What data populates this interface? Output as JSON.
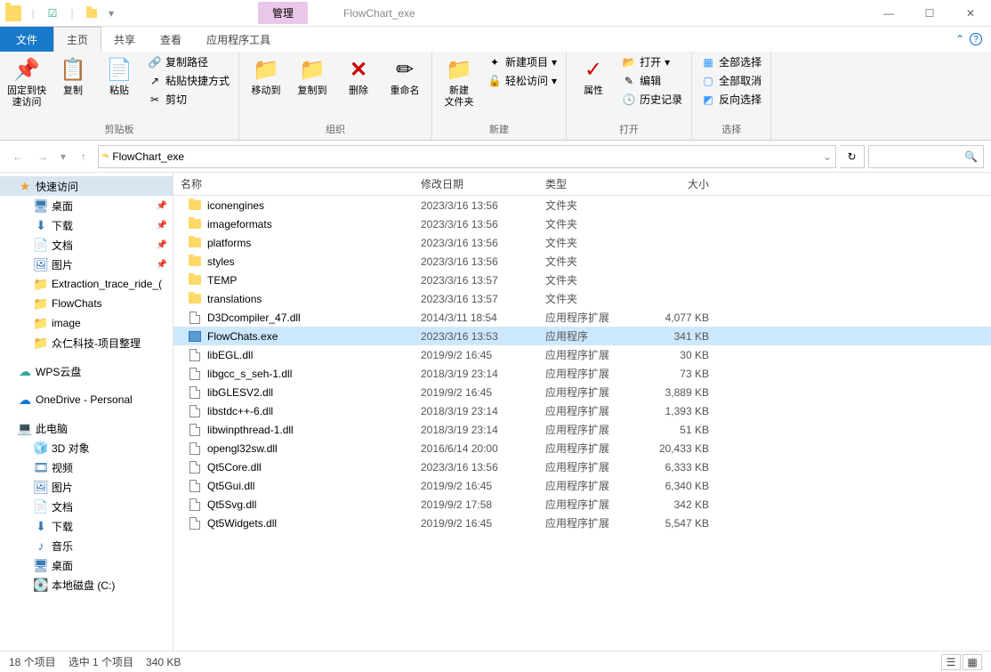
{
  "window": {
    "manage_tab": "管理",
    "title": "FlowChart_exe"
  },
  "menu": {
    "file": "文件",
    "home": "主页",
    "share": "共享",
    "view": "查看",
    "apptools": "应用程序工具"
  },
  "ribbon": {
    "clipboard": {
      "pin": "固定到快\n速访问",
      "copy": "复制",
      "paste": "粘贴",
      "copy_path": "复制路径",
      "paste_shortcut": "粘贴快捷方式",
      "cut": "剪切",
      "label": "剪贴板"
    },
    "organize": {
      "moveto": "移动到",
      "copyto": "复制到",
      "delete": "删除",
      "rename": "重命名",
      "label": "组织"
    },
    "new": {
      "newfolder": "新建\n文件夹",
      "newitem": "新建项目",
      "easyaccess": "轻松访问",
      "label": "新建"
    },
    "open": {
      "properties": "属性",
      "open": "打开",
      "edit": "编辑",
      "history": "历史记录",
      "label": "打开"
    },
    "select": {
      "selectall": "全部选择",
      "selectnone": "全部取消",
      "invert": "反向选择",
      "label": "选择"
    }
  },
  "address": {
    "path": "FlowChart_exe"
  },
  "nav": {
    "items": [
      {
        "icon": "star",
        "label": "快速访问",
        "level": 1,
        "selected": true
      },
      {
        "icon": "desktop",
        "label": "桌面",
        "level": 2,
        "pin": true
      },
      {
        "icon": "download",
        "label": "下载",
        "level": 2,
        "pin": true
      },
      {
        "icon": "doc",
        "label": "文档",
        "level": 2,
        "pin": true
      },
      {
        "icon": "pic",
        "label": "图片",
        "level": 2,
        "pin": true
      },
      {
        "icon": "folder",
        "label": "Extraction_trace_ride_(",
        "level": 2
      },
      {
        "icon": "folder",
        "label": "FlowChats",
        "level": 2
      },
      {
        "icon": "folder",
        "label": "image",
        "level": 2
      },
      {
        "icon": "folder",
        "label": "众仁科技-项目整理",
        "level": 2
      },
      {
        "sep": true
      },
      {
        "icon": "cloud-wps",
        "label": "WPS云盘",
        "level": 1
      },
      {
        "sep": true
      },
      {
        "icon": "cloud-od",
        "label": "OneDrive - Personal",
        "level": 1
      },
      {
        "sep": true
      },
      {
        "icon": "pc",
        "label": "此电脑",
        "level": 1
      },
      {
        "icon": "3d",
        "label": "3D 对象",
        "level": 2
      },
      {
        "icon": "video",
        "label": "视频",
        "level": 2
      },
      {
        "icon": "pic",
        "label": "图片",
        "level": 2
      },
      {
        "icon": "doc",
        "label": "文档",
        "level": 2
      },
      {
        "icon": "download",
        "label": "下载",
        "level": 2
      },
      {
        "icon": "music",
        "label": "音乐",
        "level": 2
      },
      {
        "icon": "desktop",
        "label": "桌面",
        "level": 2
      },
      {
        "icon": "disk",
        "label": "本地磁盘 (C:)",
        "level": 2
      }
    ]
  },
  "columns": {
    "name": "名称",
    "date": "修改日期",
    "type": "类型",
    "size": "大小"
  },
  "files": [
    {
      "icon": "folder",
      "name": "iconengines",
      "date": "2023/3/16 13:56",
      "type": "文件夹",
      "size": ""
    },
    {
      "icon": "folder",
      "name": "imageformats",
      "date": "2023/3/16 13:56",
      "type": "文件夹",
      "size": ""
    },
    {
      "icon": "folder",
      "name": "platforms",
      "date": "2023/3/16 13:56",
      "type": "文件夹",
      "size": ""
    },
    {
      "icon": "folder",
      "name": "styles",
      "date": "2023/3/16 13:56",
      "type": "文件夹",
      "size": ""
    },
    {
      "icon": "folder",
      "name": "TEMP",
      "date": "2023/3/16 13:57",
      "type": "文件夹",
      "size": ""
    },
    {
      "icon": "folder",
      "name": "translations",
      "date": "2023/3/16 13:57",
      "type": "文件夹",
      "size": ""
    },
    {
      "icon": "dll",
      "name": "D3Dcompiler_47.dll",
      "date": "2014/3/11 18:54",
      "type": "应用程序扩展",
      "size": "4,077 KB"
    },
    {
      "icon": "exe",
      "name": "FlowChats.exe",
      "date": "2023/3/16 13:53",
      "type": "应用程序",
      "size": "341 KB",
      "selected": true
    },
    {
      "icon": "dll",
      "name": "libEGL.dll",
      "date": "2019/9/2 16:45",
      "type": "应用程序扩展",
      "size": "30 KB"
    },
    {
      "icon": "dll",
      "name": "libgcc_s_seh-1.dll",
      "date": "2018/3/19 23:14",
      "type": "应用程序扩展",
      "size": "73 KB"
    },
    {
      "icon": "dll",
      "name": "libGLESV2.dll",
      "date": "2019/9/2 16:45",
      "type": "应用程序扩展",
      "size": "3,889 KB"
    },
    {
      "icon": "dll",
      "name": "libstdc++-6.dll",
      "date": "2018/3/19 23:14",
      "type": "应用程序扩展",
      "size": "1,393 KB"
    },
    {
      "icon": "dll",
      "name": "libwinpthread-1.dll",
      "date": "2018/3/19 23:14",
      "type": "应用程序扩展",
      "size": "51 KB"
    },
    {
      "icon": "dll",
      "name": "opengl32sw.dll",
      "date": "2016/6/14 20:00",
      "type": "应用程序扩展",
      "size": "20,433 KB"
    },
    {
      "icon": "dll",
      "name": "Qt5Core.dll",
      "date": "2023/3/16 13:56",
      "type": "应用程序扩展",
      "size": "6,333 KB"
    },
    {
      "icon": "dll",
      "name": "Qt5Gui.dll",
      "date": "2019/9/2 16:45",
      "type": "应用程序扩展",
      "size": "6,340 KB"
    },
    {
      "icon": "dll",
      "name": "Qt5Svg.dll",
      "date": "2019/9/2 17:58",
      "type": "应用程序扩展",
      "size": "342 KB"
    },
    {
      "icon": "dll",
      "name": "Qt5Widgets.dll",
      "date": "2019/9/2 16:45",
      "type": "应用程序扩展",
      "size": "5,547 KB"
    }
  ],
  "status": {
    "count": "18 个项目",
    "selected": "选中 1 个项目",
    "size": "340 KB"
  }
}
